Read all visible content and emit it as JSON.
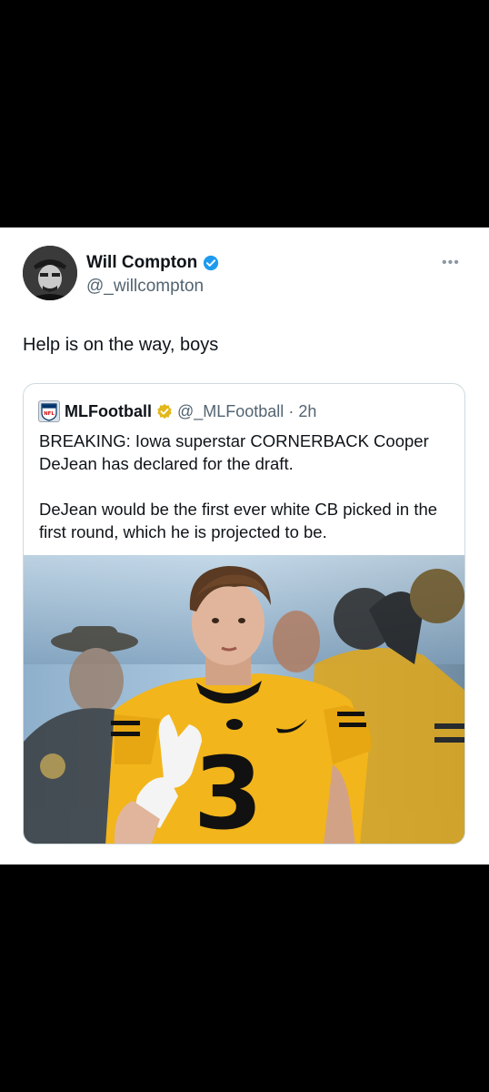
{
  "tweet": {
    "author_name": "Will Compton",
    "author_handle": "@_willcompton",
    "text": "Help is on the way, boys",
    "more_label": "•••"
  },
  "quote": {
    "author_name": "MLFootball",
    "author_handle": "@_MLFootball",
    "separator": "·",
    "time": "2h",
    "paragraph1": "BREAKING: Iowa superstar CORNERBACK Cooper DeJean has declared for the draft.",
    "paragraph2": "DeJean would be the first ever white CB picked in the first round, which he is projected to be.",
    "logo_text": "NFL",
    "jersey_number": "3"
  },
  "colors": {
    "verified_blue": "#1d9bf0",
    "verified_gold": "#e2b719",
    "jersey_gold": "#f2b51b"
  }
}
